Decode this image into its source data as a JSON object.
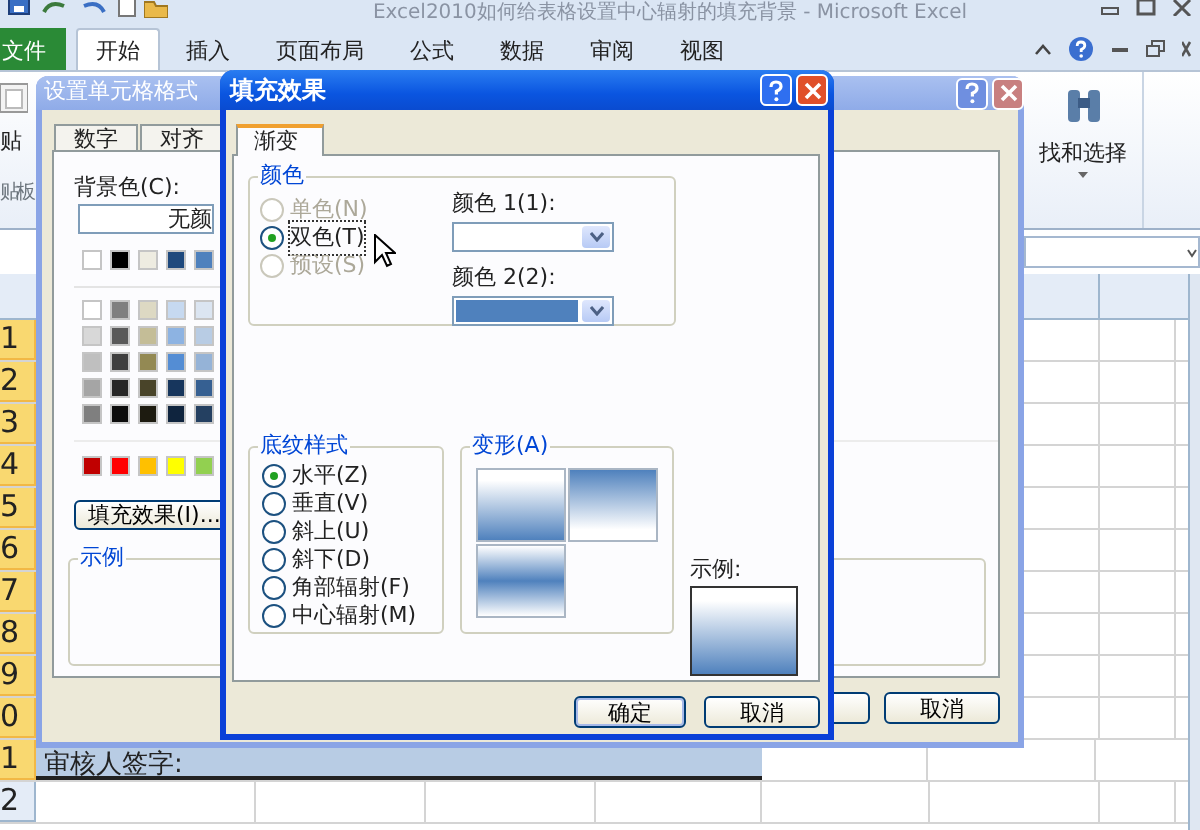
{
  "excel": {
    "title": "Excel2010如何给表格设置中心辐射的填充背景 - Microsoft Excel",
    "tabs": [
      {
        "label": "文件",
        "kind": "file",
        "selected": false
      },
      {
        "label": "开始",
        "kind": "tab",
        "selected": true
      },
      {
        "label": "插入",
        "kind": "tab",
        "selected": false
      },
      {
        "label": "页面布局",
        "kind": "tab",
        "selected": false
      },
      {
        "label": "公式",
        "kind": "tab",
        "selected": false
      },
      {
        "label": "数据",
        "kind": "tab",
        "selected": false
      },
      {
        "label": "审阅",
        "kind": "tab",
        "selected": false
      },
      {
        "label": "视图",
        "kind": "tab",
        "selected": false
      }
    ],
    "paste": {
      "label": "贴",
      "group": "贴板"
    },
    "find": {
      "label": "找和选择"
    },
    "rows": [
      {
        "header": "1",
        "selected": true
      },
      {
        "header": "2",
        "selected": true
      },
      {
        "header": "3",
        "selected": true
      },
      {
        "header": "4",
        "selected": true
      },
      {
        "header": "5",
        "selected": true
      },
      {
        "header": "6",
        "selected": true
      },
      {
        "header": "7",
        "selected": true
      },
      {
        "header": "8",
        "selected": true
      },
      {
        "header": "9",
        "selected": true
      },
      {
        "header": "0",
        "selected": true
      },
      {
        "header": "1",
        "selected": true,
        "cell": "审核人签字:"
      },
      {
        "header": "2",
        "selected": false
      }
    ]
  },
  "format_dialog": {
    "title": "设置单元格格式",
    "tabs": [
      {
        "label": "数字",
        "selected": false
      },
      {
        "label": "对齐",
        "selected": false
      }
    ],
    "background_label": "背景色(C):",
    "no_color": "无颜",
    "theme_colors": [
      {
        "color": "#ffffff"
      },
      {
        "color": "#000000"
      },
      {
        "color": "#eeece1"
      },
      {
        "color": "#1f497d"
      },
      {
        "color": "#4f81bd"
      }
    ],
    "tints": [
      {
        "swatches": [
          {
            "color": "#ffffff"
          },
          {
            "color": "#7f7f7f"
          },
          {
            "color": "#ddd9c3"
          },
          {
            "color": "#c6d9f0"
          },
          {
            "color": "#dbe5f1"
          }
        ]
      },
      {
        "swatches": [
          {
            "color": "#d8d8d8"
          },
          {
            "color": "#595959"
          },
          {
            "color": "#c4bd97"
          },
          {
            "color": "#8db3e2"
          },
          {
            "color": "#b8cce4"
          }
        ]
      },
      {
        "swatches": [
          {
            "color": "#bfbfbf"
          },
          {
            "color": "#3f3f3f"
          },
          {
            "color": "#938953"
          },
          {
            "color": "#548dd4"
          },
          {
            "color": "#95b3d7"
          }
        ]
      },
      {
        "swatches": [
          {
            "color": "#a5a5a5"
          },
          {
            "color": "#262626"
          },
          {
            "color": "#494429"
          },
          {
            "color": "#17365d"
          },
          {
            "color": "#366092"
          }
        ]
      },
      {
        "swatches": [
          {
            "color": "#7f7f7f"
          },
          {
            "color": "#0c0c0c"
          },
          {
            "color": "#1d1b10"
          },
          {
            "color": "#0f243e"
          },
          {
            "color": "#244061"
          }
        ]
      }
    ],
    "standard_colors": [
      {
        "color": "#c00000"
      },
      {
        "color": "#ff0000"
      },
      {
        "color": "#ffc000"
      },
      {
        "color": "#ffff00"
      },
      {
        "color": "#92d050"
      }
    ],
    "fill_effects_button": "填充效果(I)...",
    "sample_label": "示例",
    "cancel_button": "取消"
  },
  "fill_dialog": {
    "title": "填充效果",
    "tabs": [
      {
        "label": "渐变",
        "selected": true
      }
    ],
    "colors_group": "颜色",
    "color_modes": [
      {
        "label": "单色(N)",
        "selected": false,
        "disabled": true
      },
      {
        "label": "双色(T)",
        "selected": true,
        "disabled": false
      },
      {
        "label": "预设(S)",
        "selected": false,
        "disabled": true
      }
    ],
    "color1": {
      "label": "颜色 1(1):"
    },
    "color2": {
      "label": "颜色 2(2):",
      "color": "#4f81bd"
    },
    "shading_group": "底纹样式",
    "shading_styles": [
      {
        "label": "水平(Z)",
        "selected": true
      },
      {
        "label": "垂直(V)",
        "selected": false
      },
      {
        "label": "斜上(U)",
        "selected": false
      },
      {
        "label": "斜下(D)",
        "selected": false
      },
      {
        "label": "角部辐射(F)",
        "selected": false
      },
      {
        "label": "中心辐射(M)",
        "selected": false
      }
    ],
    "variants_group": "变形(A)",
    "variants": [
      {
        "kind": "down"
      },
      {
        "kind": "up"
      },
      {
        "kind": "middle"
      }
    ],
    "sample_label": "示例:",
    "ok_button": "确定",
    "cancel_button": "取消"
  }
}
